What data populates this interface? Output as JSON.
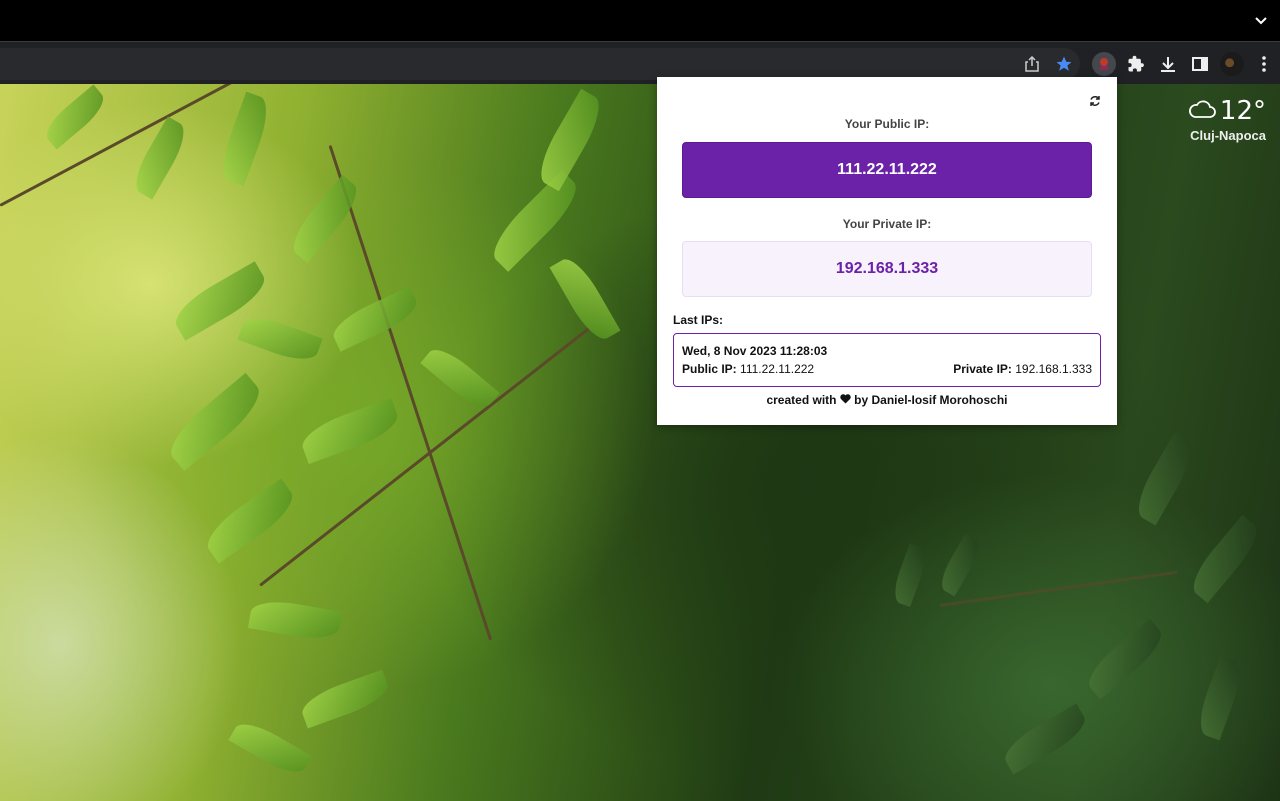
{
  "weather": {
    "temperature": "12°",
    "city": "Cluj-Napoca",
    "icon": "cloud-icon"
  },
  "toolbar": {
    "icons": [
      "share-icon",
      "bookmark-star-icon",
      "extension-ip-icon",
      "puzzle-extensions-icon",
      "download-icon",
      "side-panel-icon",
      "profile-avatar",
      "kebab-menu-icon"
    ],
    "star_color": "#4a8af4"
  },
  "popup": {
    "refresh_icon": "refresh-icon",
    "public_label": "Your Public IP:",
    "public_ip": "111.22.11.222",
    "private_label": "Your Private IP:",
    "private_ip": "192.168.1.333",
    "history_label": "Last IPs:",
    "history": [
      {
        "date": "Wed, 8 Nov 2023 11:28:03",
        "public_label": "Public IP:",
        "public_ip": "111.22.11.222",
        "private_label": "Private IP:",
        "private_ip": "192.168.1.333"
      }
    ],
    "footer_prefix": "created with",
    "footer_suffix": "by Daniel-Iosif Morohoschi",
    "accent": "#6b21a8",
    "accent_light": "#f7f2fc"
  }
}
